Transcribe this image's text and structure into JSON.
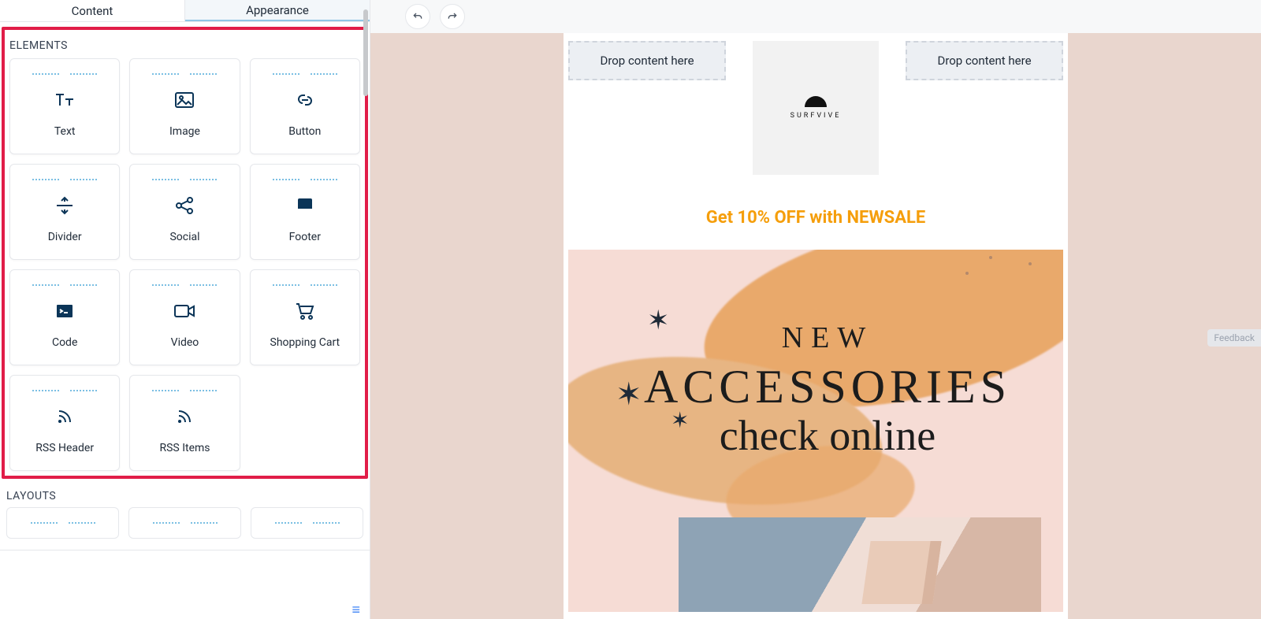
{
  "sidebar": {
    "tabs": {
      "content": "Content",
      "appearance": "Appearance"
    },
    "sections": {
      "elements": "ELEMENTS",
      "layouts": "LAYOUTS"
    },
    "elements": {
      "text": "Text",
      "image": "Image",
      "button": "Button",
      "divider": "Divider",
      "social": "Social",
      "footer": "Footer",
      "code": "Code",
      "video": "Video",
      "shopping_cart": "Shopping Cart",
      "rss_header": "RSS Header",
      "rss_items": "RSS Items"
    }
  },
  "canvas": {
    "drop_label": "Drop content here",
    "brand": "SURFVIVE",
    "promo": "Get 10% OFF with NEWSALE",
    "hero": {
      "line1": "NEW",
      "line2": "ACCESSORIES",
      "line3": "check online"
    }
  },
  "misc": {
    "feedback": "Feedback"
  }
}
